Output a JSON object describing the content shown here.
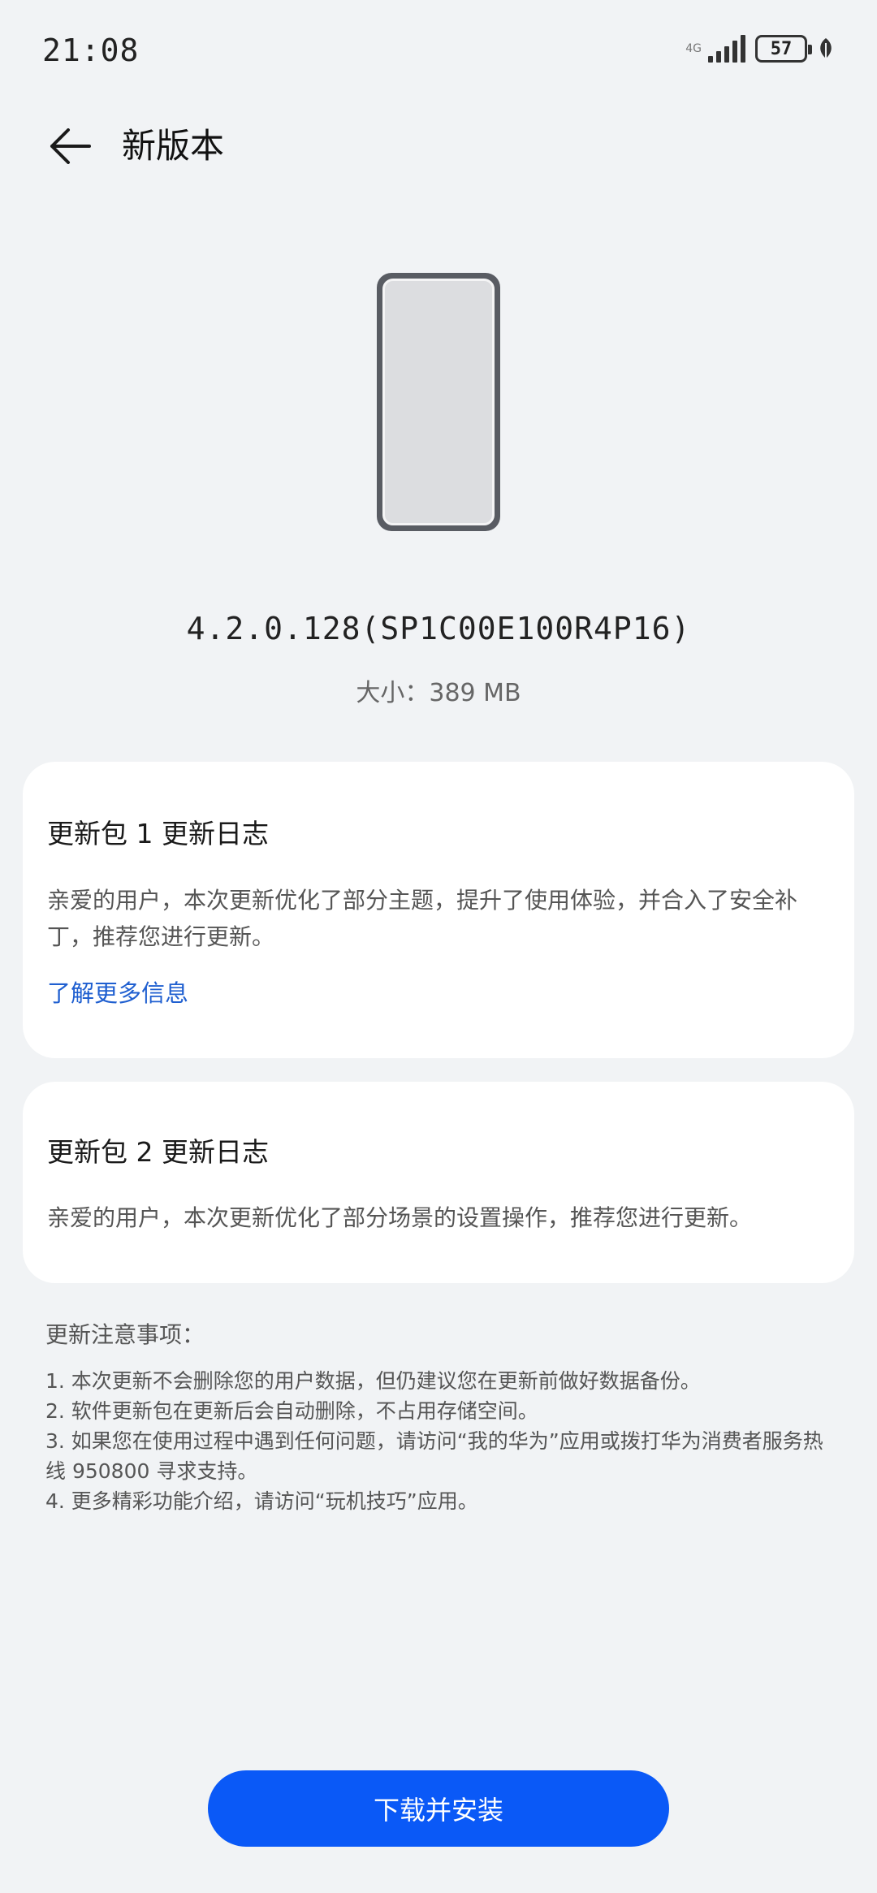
{
  "status_bar": {
    "time": "21:08",
    "network_label": "4G",
    "battery_level": "57"
  },
  "header": {
    "title": "新版本"
  },
  "release": {
    "version": "4.2.0.128(SP1C00E100R4P16)",
    "size": "大小：389 MB"
  },
  "update_packages": [
    {
      "title": "更新包 1 更新日志",
      "body": "亲爱的用户，本次更新优化了部分主题，提升了使用体验，并合入了安全补丁，推荐您进行更新。",
      "link": "了解更多信息"
    },
    {
      "title": "更新包 2 更新日志",
      "body": "亲爱的用户，本次更新优化了部分场景的设置操作，推荐您进行更新。"
    }
  ],
  "notes": {
    "title": "更新注意事项：",
    "items": [
      "1. 本次更新不会删除您的用户数据，但仍建议您在更新前做好数据备份。",
      "2. 软件更新包在更新后会自动删除，不占用存储空间。",
      "3. 如果您在使用过程中遇到任何问题，请访问“我的华为”应用或拨打华为消费者服务热线 950800 寻求支持。",
      "4. 更多精彩功能介绍，请访问“玩机技巧”应用。"
    ]
  },
  "actions": {
    "install_label": "下载并安装"
  },
  "colors": {
    "background": "#f1f3f5",
    "card": "#ffffff",
    "accent": "#0a59f7",
    "link": "#1f5fd0"
  }
}
